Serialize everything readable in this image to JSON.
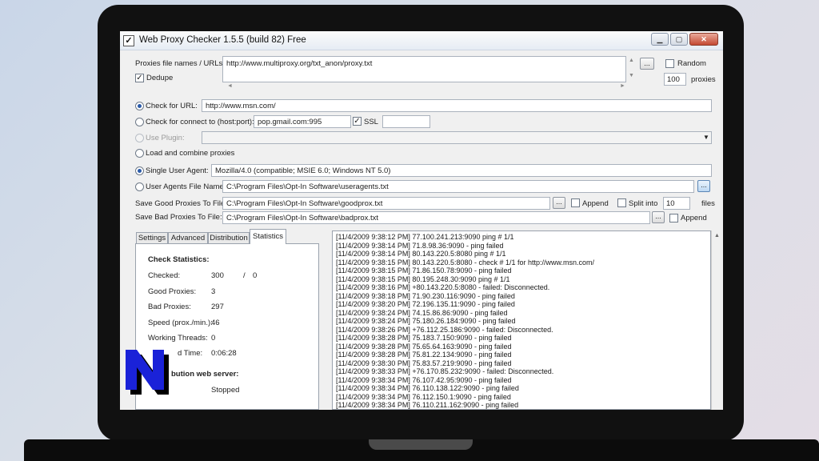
{
  "window": {
    "title": "Web Proxy Checker 1.5.5 (build 82) Free",
    "app_icon": "✓"
  },
  "proxies": {
    "label": "Proxies file names / URLs:",
    "value": "http://www.multiproxy.org/txt_anon/proxy.txt",
    "browse_label": "...",
    "dedupe_label": "Dedupe",
    "random_label": "Random",
    "count": "100",
    "count_unit": "proxies"
  },
  "checks": {
    "url_label": "Check for URL:",
    "url_value": "http://www.msn.com/",
    "connect_label": "Check for connect to (host:port):",
    "connect_value": "pop.gmail.com:995",
    "ssl_label": "SSL",
    "plugin_label": "Use Plugin:",
    "combine_label": "Load and combine proxies"
  },
  "agent": {
    "single_label": "Single User Agent:",
    "single_value": "Mozilla/4.0 (compatible; MSIE 6.0; Windows NT 5.0)",
    "file_label": "User Agents File Name:",
    "file_value": "C:\\Program Files\\Opt-In Software\\useragents.txt",
    "browse_label": "..."
  },
  "save": {
    "good_label": "Save Good Proxies To File:",
    "good_value": "C:\\Program Files\\Opt-In Software\\goodprox.txt",
    "append_label": "Append",
    "split_label": "Split into",
    "split_value": "10",
    "files_label": "files",
    "bad_label": "Save Bad Proxies To File:",
    "bad_value": "C:\\Program Files\\Opt-In Software\\badprox.txt",
    "bad_append_label": "Append",
    "browse_label": "..."
  },
  "tabs": [
    "Settings",
    "Advanced",
    "Distribution",
    "Statistics"
  ],
  "stats": {
    "heading": "Check Statistics:",
    "checked_label": "Checked:",
    "checked_value": "300",
    "checked_sep": "/",
    "checked_total": "0",
    "good_label": "Good Proxies:",
    "good_value": "3",
    "bad_label": "Bad Proxies:",
    "bad_value": "297",
    "speed_label": "Speed (prox./min.):",
    "speed_value": "46",
    "threads_label": "Working Threads:",
    "threads_value": "0",
    "time_label": "d Time:",
    "time_value": "0:06:28",
    "dist_label": "bution web server:",
    "dist_value": "Stopped"
  },
  "log": [
    "[11/4/2009 9:38:12 PM] 77.100.241.213:9090 ping # 1/1",
    "[11/4/2009 9:38:14 PM] 71.8.98.36:9090 - ping failed",
    "[11/4/2009 9:38:14 PM] 80.143.220.5:8080 ping # 1/1",
    "[11/4/2009 9:38:15 PM] 80.143.220.5:8080 - check # 1/1 for http://www.msn.com/",
    "[11/4/2009 9:38:15 PM] 71.86.150.78:9090 - ping failed",
    "[11/4/2009 9:38:15 PM] 80.195.248.30:9090 ping # 1/1",
    "[11/4/2009 9:38:16 PM] +80.143.220.5:8080 - failed: Disconnected.",
    "[11/4/2009 9:38:18 PM] 71.90.230.116:9090 - ping failed",
    "[11/4/2009 9:38:20 PM] 72.196.135.11:9090 - ping failed",
    "[11/4/2009 9:38:24 PM] 74.15.86.86:9090 - ping failed",
    "[11/4/2009 9:38:24 PM] 75.180.26.184:9090 - ping failed",
    "[11/4/2009 9:38:26 PM] +76.112.25.186:9090 - failed: Disconnected.",
    "[11/4/2009 9:38:28 PM] 75.183.7.150:9090 - ping failed",
    "[11/4/2009 9:38:28 PM] 75.65.64.163:9090 - ping failed",
    "[11/4/2009 9:38:28 PM] 75.81.22.134:9090 - ping failed",
    "[11/4/2009 9:38:30 PM] 75.83.57.219:9090 - ping failed",
    "[11/4/2009 9:38:33 PM] +76.170.85.232:9090 - failed: Disconnected.",
    "[11/4/2009 9:38:34 PM] 76.107.42.95:9090 - ping failed",
    "[11/4/2009 9:38:34 PM] 76.110.138.122:9090 - ping failed",
    "[11/4/2009 9:38:34 PM] 76.112.150.1:9090 - ping failed",
    "[11/4/2009 9:38:34 PM] 76.110.211.162:9090 - ping failed"
  ],
  "icons": {
    "minimize": "minimize-icon",
    "maximize": "maximize-icon",
    "close": "close-icon",
    "logo": "n-logo-icon"
  },
  "colors": {
    "logo_fill": "#1a22d8",
    "logo_shadow": "#000000",
    "radio_dot": "#2a5aa8"
  }
}
